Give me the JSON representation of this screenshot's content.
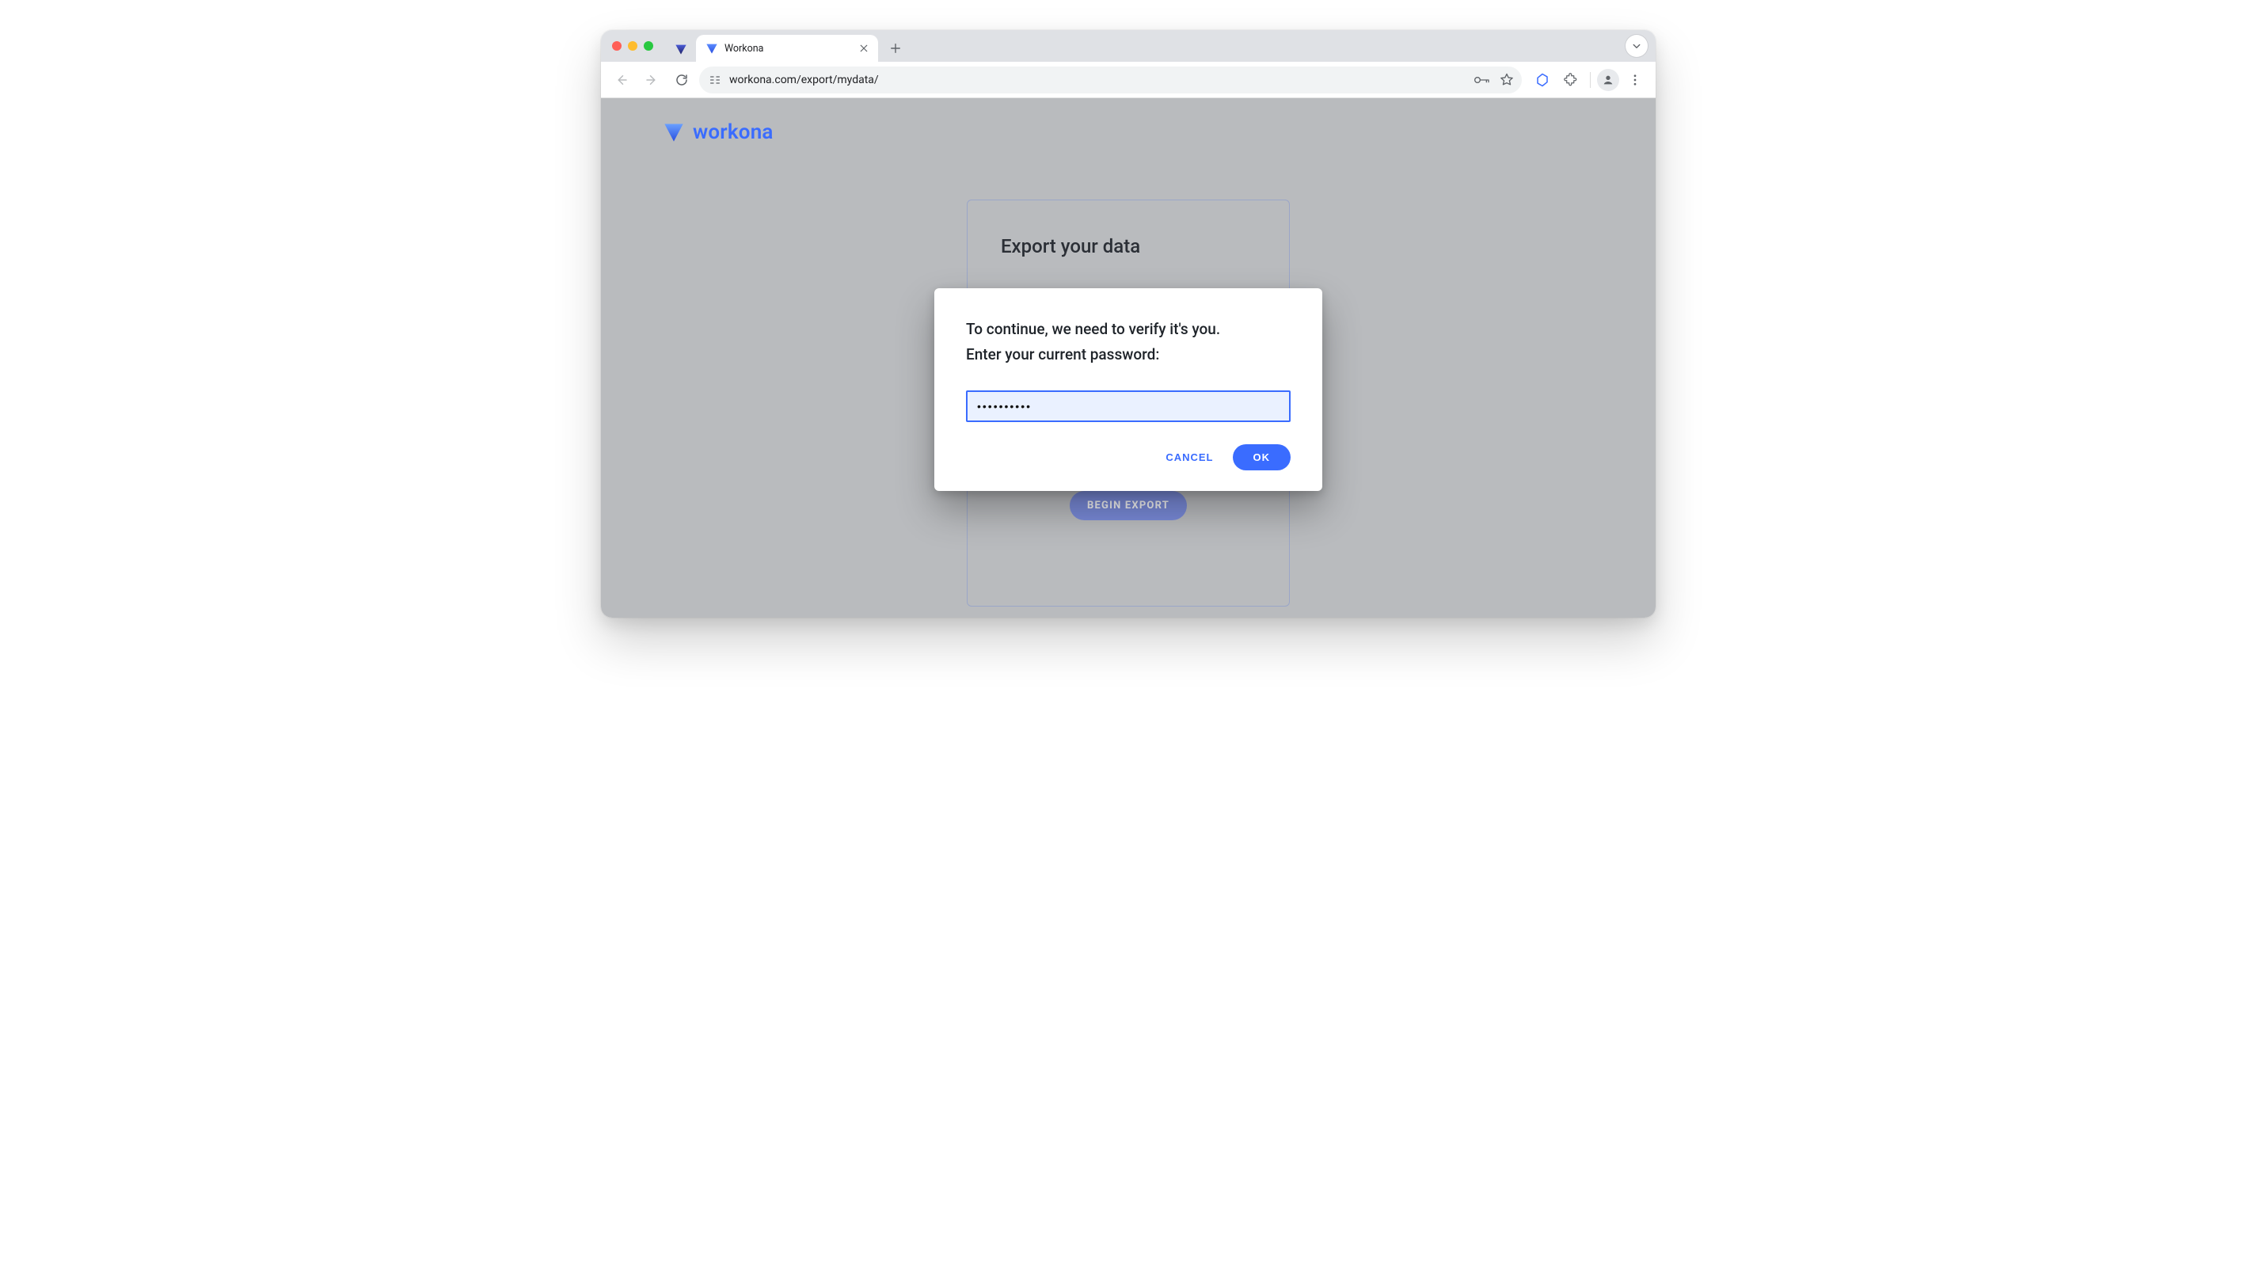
{
  "browser": {
    "tab": {
      "title": "Workona"
    },
    "url": "workona.com/export/mydata/"
  },
  "brand": {
    "name": "workona"
  },
  "card": {
    "title": "Export your data",
    "begin_label": "BEGIN EXPORT"
  },
  "modal": {
    "message_line1": "To continue, we need to verify it's you.",
    "message_line2": "Enter your current password:",
    "password_value": "••••••••••",
    "cancel_label": "CANCEL",
    "ok_label": "OK"
  }
}
